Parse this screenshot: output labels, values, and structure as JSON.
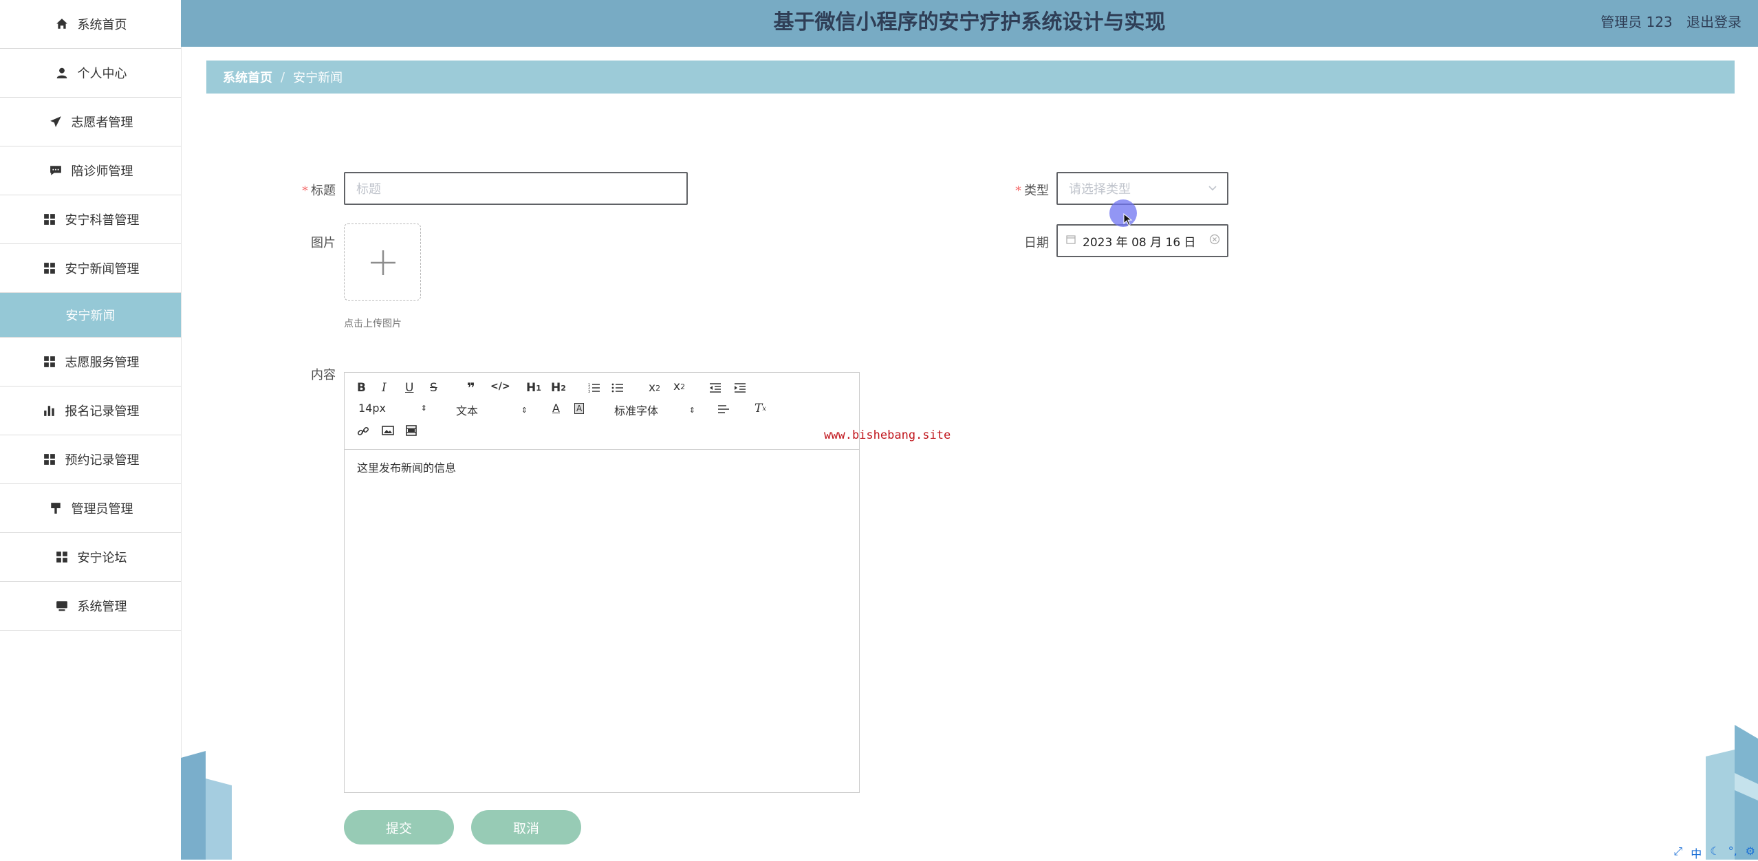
{
  "header": {
    "title": "基于微信小程序的安宁疗护系统设计与实现",
    "user_label": "管理员 123",
    "logout_label": "退出登录"
  },
  "sidebar": {
    "items": [
      {
        "label": "系统首页",
        "icon": "home-icon"
      },
      {
        "label": "个人中心",
        "icon": "person-icon"
      },
      {
        "label": "志愿者管理",
        "icon": "paper-plane-icon"
      },
      {
        "label": "陪诊师管理",
        "icon": "chat-icon"
      },
      {
        "label": "安宁科普管理",
        "icon": "grid-icon"
      },
      {
        "label": "安宁新闻管理",
        "icon": "grid-icon"
      },
      {
        "label": "安宁新闻",
        "icon": "",
        "sub": true
      },
      {
        "label": "志愿服务管理",
        "icon": "grid-icon"
      },
      {
        "label": "报名记录管理",
        "icon": "bar-chart-icon"
      },
      {
        "label": "预约记录管理",
        "icon": "grid-icon"
      },
      {
        "label": "管理员管理",
        "icon": "brush-icon"
      },
      {
        "label": "安宁论坛",
        "icon": "grid-icon"
      },
      {
        "label": "系统管理",
        "icon": "monitor-icon"
      }
    ]
  },
  "breadcrumb": {
    "home": "系统首页",
    "separator": "/",
    "current": "安宁新闻"
  },
  "form": {
    "title_label": "标题",
    "title_placeholder": "标题",
    "type_label": "类型",
    "type_placeholder": "请选择类型",
    "image_label": "图片",
    "upload_hint": "点击上传图片",
    "date_label": "日期",
    "date_value": "2023 年 08 月 16 日",
    "content_label": "内容",
    "required_mark": "*"
  },
  "editor": {
    "font_size": "14px",
    "header_select": "文本",
    "font_family": "标准字体",
    "content": "这里发布新闻的信息"
  },
  "buttons": {
    "submit": "提交",
    "cancel": "取消"
  },
  "watermark": "www.bishebang.site",
  "ime": [
    "中"
  ],
  "colors": {
    "header_bg": "#78abc4",
    "breadcrumb_bg": "#9ccbd8",
    "sidebar_active": "#95c8d6",
    "button_bg": "#97cbb5",
    "required": "#f56c6c"
  }
}
